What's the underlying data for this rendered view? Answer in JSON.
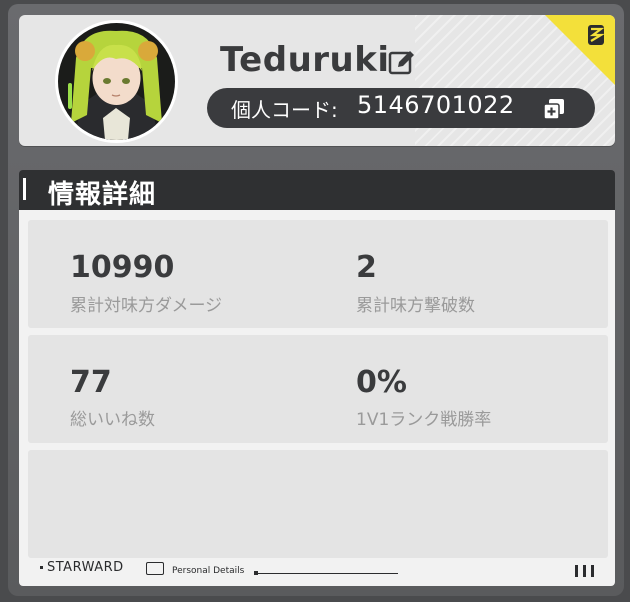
{
  "profile": {
    "username": "Teduruki",
    "code_label": "個人コード:",
    "code_value": "5146701022"
  },
  "section": {
    "title": "情報詳細"
  },
  "stats": [
    {
      "value": "10990",
      "label": "累計対味方ダメージ"
    },
    {
      "value": "2",
      "label": "累計味方撃破数"
    },
    {
      "value": "77",
      "label": "総いいね数"
    },
    {
      "value": "0%",
      "label": "1V1ランク戦勝率"
    }
  ],
  "footer": {
    "brand": "STARWARD",
    "subtitle": "Personal Details"
  },
  "colors": {
    "accent_yellow": "#f3e03a",
    "dark": "#2f3032",
    "pill": "#3a3b3e"
  },
  "icons": {
    "edit": "edit-icon",
    "copy": "copy-icon",
    "brand": "starward-logo-icon"
  }
}
